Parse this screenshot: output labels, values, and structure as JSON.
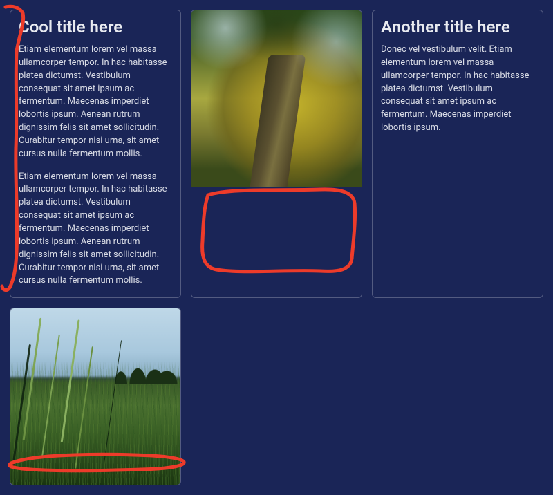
{
  "cards": [
    {
      "title": "Cool title here",
      "paragraphs": [
        "Etiam elementum lorem vel massa ullamcorper tempor. In hac habitasse platea dictumst. Vestibulum consequat sit amet ipsum ac fermentum. Maecenas imperdiet lobortis ipsum. Aenean rutrum dignissim felis sit amet sollicitudin. Curabitur tempor nisi urna, sit amet cursus nulla fermentum mollis.",
        "Etiam elementum lorem vel massa ullamcorper tempor. In hac habitasse platea dictumst. Vestibulum consequat sit amet ipsum ac fermentum. Maecenas imperdiet lobortis ipsum. Aenean rutrum dignissim felis sit amet sollicitudin. Curabitur tempor nisi urna, sit amet cursus nulla fermentum mollis."
      ]
    },
    {
      "title": "Another title here",
      "paragraphs": [
        "Donec vel vestibulum velit. Etiam elementum lorem vel massa ullamcorper tempor. In hac habitasse platea dictumst. Vestibulum consequat sit amet ipsum ac fermentum. Maecenas imperdiet lobortis ipsum."
      ]
    }
  ]
}
